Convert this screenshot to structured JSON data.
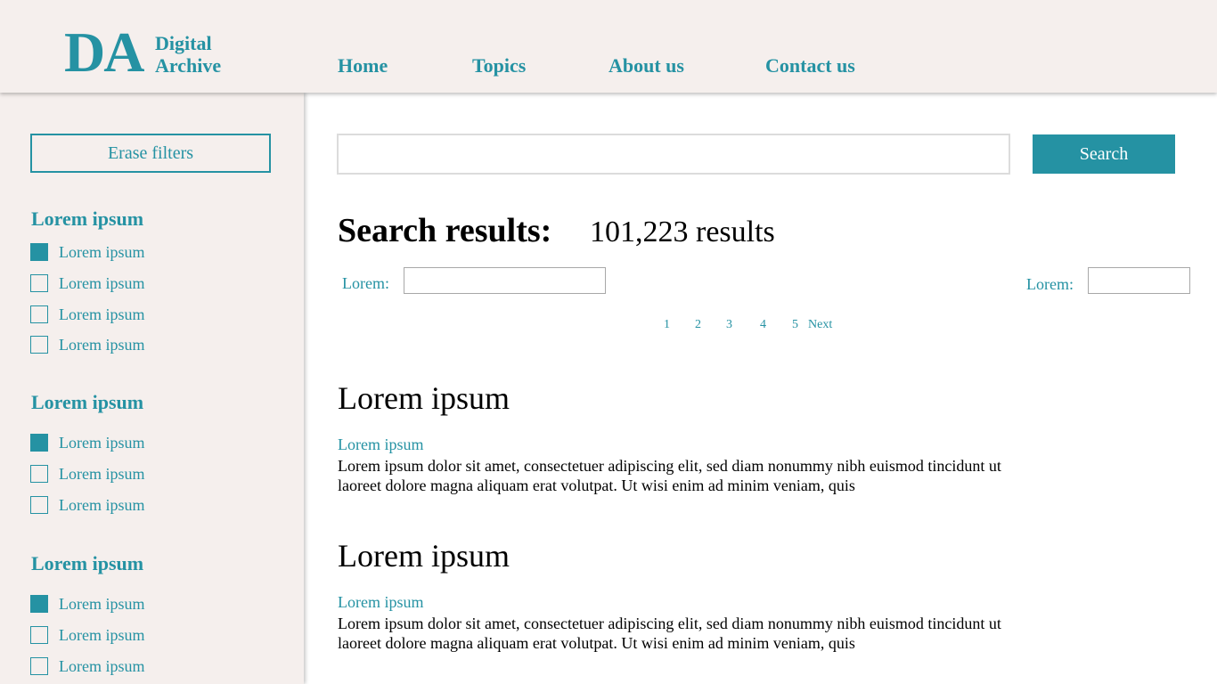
{
  "header": {
    "logo_mark": "DA",
    "logo_line1": "Digital",
    "logo_line2": "Archive",
    "nav": [
      "Home",
      "Topics",
      "About us",
      "Contact us"
    ]
  },
  "sidebar": {
    "erase_label": "Erase filters",
    "groups": [
      {
        "heading": "Lorem ipsum",
        "options": [
          {
            "label": "Lorem ipsum",
            "checked": true
          },
          {
            "label": "Lorem ipsum",
            "checked": false
          },
          {
            "label": "Lorem ipsum",
            "checked": false
          },
          {
            "label": "Lorem ipsum",
            "checked": false
          }
        ]
      },
      {
        "heading": "Lorem ipsum",
        "options": [
          {
            "label": "Lorem ipsum",
            "checked": true
          },
          {
            "label": "Lorem ipsum",
            "checked": false
          },
          {
            "label": "Lorem ipsum",
            "checked": false
          }
        ]
      },
      {
        "heading": "Lorem ipsum",
        "options": [
          {
            "label": "Lorem ipsum",
            "checked": true
          },
          {
            "label": "Lorem ipsum",
            "checked": false
          },
          {
            "label": "Lorem ipsum",
            "checked": false
          }
        ]
      }
    ]
  },
  "search": {
    "value": "",
    "placeholder": "",
    "button_label": "Search"
  },
  "results": {
    "title": "Search results:",
    "count": "101,223 results",
    "filter_left_label": "Lorem:",
    "filter_right_label": "Lorem:",
    "pagination": [
      "1",
      "2",
      "3",
      "4",
      "5",
      "Next"
    ],
    "items": [
      {
        "title": "Lorem ipsum",
        "subtitle": "Lorem ipsum",
        "body": "Lorem ipsum dolor sit amet, consectetuer adipiscing elit, sed diam nonummy nibh euismod tincidunt ut laoreet dolore magna aliquam erat volutpat. Ut wisi enim ad minim veniam, quis"
      },
      {
        "title": "Lorem ipsum",
        "subtitle": "Lorem ipsum",
        "body": "Lorem ipsum dolor sit amet, consectetuer adipiscing elit, sed diam nonummy nibh euismod tincidunt ut laoreet dolore magna aliquam erat volutpat. Ut wisi enim ad minim veniam, quis"
      }
    ]
  },
  "colors": {
    "accent": "#2592a3",
    "panel_bg": "#f5efed"
  }
}
